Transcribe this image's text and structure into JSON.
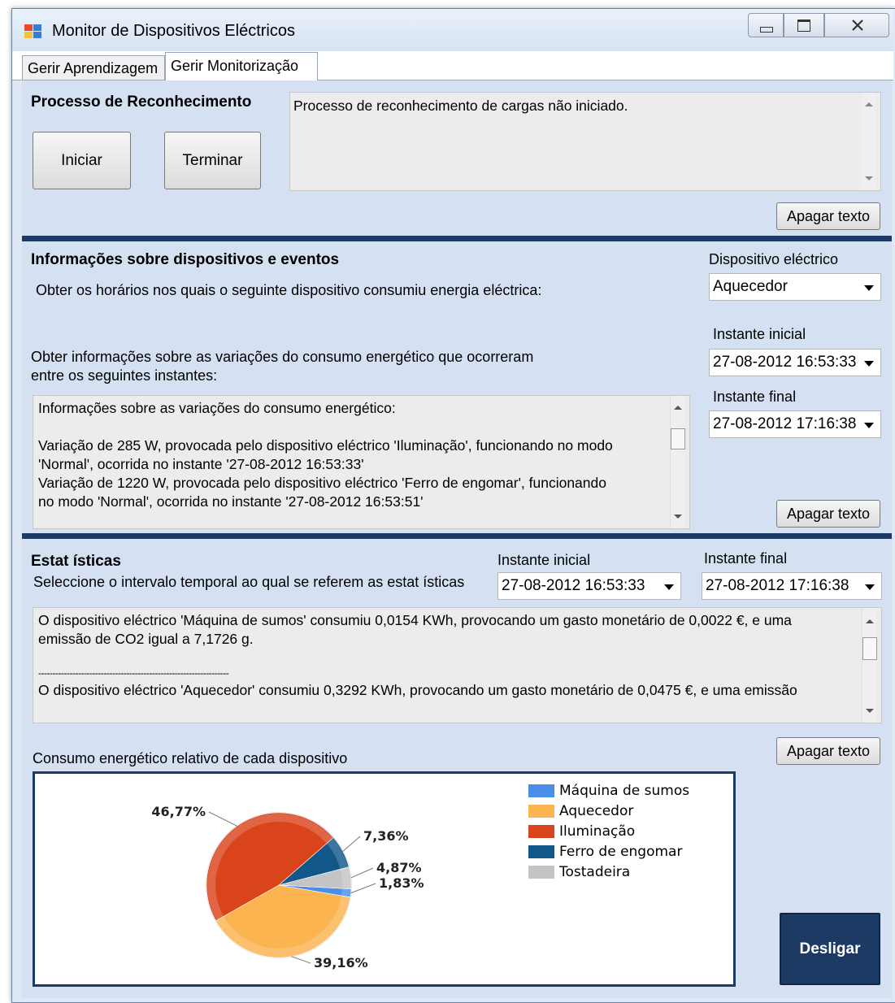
{
  "window": {
    "title": "Monitor de Dispositivos Eléctricos"
  },
  "tabs": [
    {
      "label": "Gerir Aprendizagem"
    },
    {
      "label": "Gerir Monitorização"
    }
  ],
  "recognition": {
    "heading": "Processo de Reconhecimento",
    "start_label": "Iniciar",
    "stop_label": "Terminar",
    "log_text": "Processo de reconhecimento de cargas não iniciado.",
    "clear_label": "Apagar texto"
  },
  "devices_info": {
    "heading": "Informações sobre dispositivos e eventos",
    "query_text": "Obter os horários nos quais o seguinte dispositivo consumiu energia eléctrica:",
    "device_label": "Dispositivo eléctrico",
    "device_value": "Aquecedor",
    "variation_text_line1": "Obter informações sobre as variações do consumo energético que ocorreram",
    "variation_text_line2": "entre os seguintes instantes:",
    "start_label": "Instante inicial",
    "start_value": "27-08-2012 16:53:33",
    "end_label": "Instante final",
    "end_value": "27-08-2012 17:16:38",
    "log_lines": [
      "Informações sobre as variações do consumo energético:",
      "",
      "Variação de 285 W, provocada pelo dispositivo eléctrico 'Iluminação', funcionando no modo",
      "'Normal', ocorrida no instante '27-08-2012 16:53:33'",
      "Variação de 1220 W, provocada pelo dispositivo eléctrico 'Ferro de engomar', funcionando",
      "no modo 'Normal', ocorrida no instante '27-08-2012 16:53:51'"
    ],
    "clear_label": "Apagar texto"
  },
  "statistics": {
    "heading": "Estat ísticas",
    "subtitle": "Seleccione o intervalo temporal ao qual se referem as estat ísticas",
    "start_label": "Instante inicial",
    "start_value": "27-08-2012 16:53:33",
    "end_label": "Instante final",
    "end_value": "27-08-2012 17:16:38",
    "log_lines": [
      "O dispositivo eléctrico 'Máquina de sumos' consumiu 0,0154 KWh, provocando um gasto monetário de 0,0022 €, e uma",
      "emissão de CO2 igual a 7,1726 g.",
      "",
      "-------------------------------------------------------------------",
      "O dispositivo eléctrico 'Aquecedor' consumiu 0,3292 KWh, provocando um gasto monetário de 0,0475 €, e uma emissão"
    ],
    "clear_label": "Apagar texto",
    "chart_caption": "Consumo energético relativo de cada dispositivo",
    "off_label": "Desligar"
  },
  "chart_data": {
    "type": "pie",
    "title": "",
    "slices": [
      {
        "name": "Máquina de sumos",
        "value": 1.83,
        "label": "1,83%",
        "color": "#4a8ee8"
      },
      {
        "name": "Aquecedor",
        "value": 39.16,
        "label": "39,16%",
        "color": "#fbb44f"
      },
      {
        "name": "Iluminação",
        "value": 46.77,
        "label": "46,77%",
        "color": "#d9441b"
      },
      {
        "name": "Ferro de engomar",
        "value": 7.36,
        "label": "7,36%",
        "color": "#12578a"
      },
      {
        "name": "Tostadeira",
        "value": 4.87,
        "label": "4,87%",
        "color": "#c4c4c4"
      }
    ],
    "legend": "top-right"
  },
  "colors": {
    "section_bg": "#d5e1f2",
    "separator": "#1d3a65",
    "off_button": "#1d3a65"
  }
}
